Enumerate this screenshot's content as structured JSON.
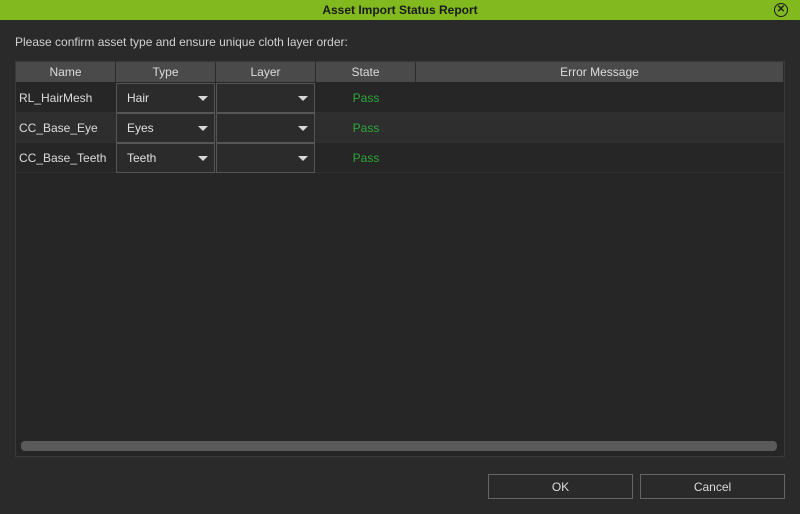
{
  "window": {
    "title": "Asset Import Status Report"
  },
  "instruction": "Please confirm asset type and ensure unique cloth layer order:",
  "table": {
    "columns": [
      "Name",
      "Type",
      "Layer",
      "State",
      "Error Message"
    ],
    "rows": [
      {
        "name": "RL_HairMesh",
        "type": "Hair",
        "layer": "",
        "state": "Pass",
        "error": ""
      },
      {
        "name": "CC_Base_Eye",
        "type": "Eyes",
        "layer": "",
        "state": "Pass",
        "error": ""
      },
      {
        "name": "CC_Base_Teeth",
        "type": "Teeth",
        "layer": "",
        "state": "Pass",
        "error": ""
      }
    ]
  },
  "buttons": {
    "ok": "OK",
    "cancel": "Cancel"
  },
  "colors": {
    "titlebar": "#82b91e",
    "pass": "#2ea63a"
  },
  "icons": {
    "close": "close-circle-icon",
    "dropdown": "chevron-down-icon"
  }
}
